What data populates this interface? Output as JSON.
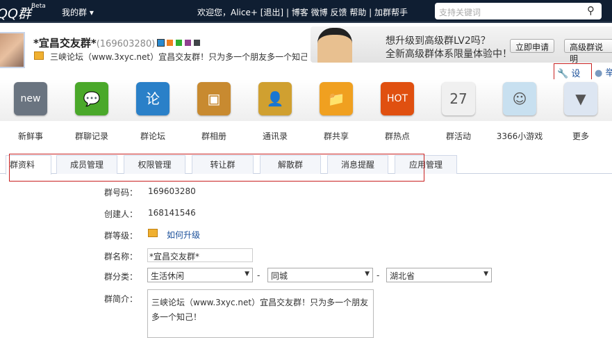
{
  "topbar": {
    "logo": "QQ群",
    "beta": "Beta",
    "my_groups": "我的群 ▾",
    "welcome": "欢迎您，Alice+",
    "logout": "[退出]",
    "links": [
      "博客",
      "微博",
      "反馈",
      "帮助"
    ],
    "join_helper": "加群帮手",
    "search_placeholder": "支持关键词"
  },
  "group": {
    "name": "*宜昌交友群*",
    "number": "(169603280)",
    "description": "三峡论坛（www.3xyc.net）宜昌交友群！只为多一个朋友多一个知己！",
    "theme_colors": [
      "#2a8ad0",
      "#f08020",
      "#30b030",
      "#904090",
      "#404448"
    ]
  },
  "banner": {
    "line1": "想升级到高级群LV2吗？",
    "line2": "全新高级群体系限量体验中！",
    "apply_button": "立即申请",
    "info_button": "高级群说明"
  },
  "actions": {
    "settings": "设置",
    "report": "举"
  },
  "apps": [
    {
      "label": "新鲜事",
      "icon": "new-icon",
      "color": "#6a7480",
      "glyph": "new"
    },
    {
      "label": "群聊记录",
      "icon": "chat-bubbles-icon",
      "color": "#4aa82a",
      "glyph": "💬"
    },
    {
      "label": "群论坛",
      "icon": "forum-icon",
      "color": "#2a80c8",
      "glyph": "论"
    },
    {
      "label": "群相册",
      "icon": "photo-album-icon",
      "color": "#c88a30",
      "glyph": "▣"
    },
    {
      "label": "通讯录",
      "icon": "contacts-icon",
      "color": "#d0a030",
      "glyph": "👤"
    },
    {
      "label": "群共享",
      "icon": "folder-icon",
      "color": "#f0a020",
      "glyph": "📁"
    },
    {
      "label": "群热点",
      "icon": "hot-icon",
      "color": "#e05010",
      "glyph": "HOT"
    },
    {
      "label": "群活动",
      "icon": "calendar-icon",
      "color": "#f0f0f0",
      "glyph": "27"
    },
    {
      "label": "3366小游戏",
      "icon": "game-mascot-icon",
      "color": "#c8e0f0",
      "glyph": "☺"
    },
    {
      "label": "更多",
      "icon": "more-arrow-icon",
      "color": "#dde6f2",
      "glyph": "▼"
    }
  ],
  "tabs": [
    "群资料",
    "成员管理",
    "权限管理",
    "转让群",
    "解散群",
    "消息提醒",
    "应用管理"
  ],
  "form": {
    "number_label": "群号码：",
    "number": "169603280",
    "creator_label": "创建人：",
    "creator": "168141546",
    "level_label": "群等级：",
    "level_link": "如何升级",
    "name_label": "群名称：",
    "name_value": "*宜昌交友群*",
    "category_label": "群分类：",
    "category1": "生活休闲",
    "category2": "同城",
    "category3": "湖北省",
    "separator": "-",
    "intro_label": "群简介：",
    "intro_line1": "三峡论坛（www.3xyc.net）宜昌交友群！只为多一个朋友",
    "intro_line2": "多一个知己！"
  }
}
